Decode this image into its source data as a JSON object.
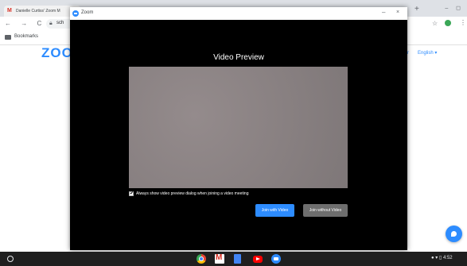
{
  "browser": {
    "tab_title": "Danielle Curtiss' Zoom M",
    "tab_close": "×",
    "new_tab": "+",
    "window_controls": "– ◻",
    "nav_icons": "← → C ⌂",
    "url_text": "sch",
    "bookmarks_label": "Bookmarks"
  },
  "page": {
    "logo": "ZOO",
    "right_stub": "r",
    "language": "English ▾"
  },
  "zoom_window": {
    "title": "Zoom",
    "minimize": "–",
    "close": "×",
    "dialog_title": "Video Preview",
    "checkbox_checked": true,
    "checkbox_mark": "✔",
    "checkbox_label": "Always show video preview dialog when joining a video meeting",
    "join_with_video": "Join with Video",
    "join_without_video": "Join without Video"
  },
  "shelf": {
    "tray_text": "● ▾ ▯ 4:52"
  },
  "colors": {
    "zoom_blue": "#2d8cff",
    "dialog_bg": "#000000",
    "preview_gray": "#8b8384",
    "shelf_bg": "#1f1f1f"
  },
  "icons": [
    "gmail-icon",
    "lock-icon",
    "star-icon",
    "extension-icon",
    "menu-icon",
    "folder-icon",
    "zoom-icon",
    "launcher-icon",
    "chrome-icon",
    "gmail-app-icon",
    "docs-icon",
    "youtube-icon",
    "zoom-app-icon",
    "chat-icon"
  ]
}
